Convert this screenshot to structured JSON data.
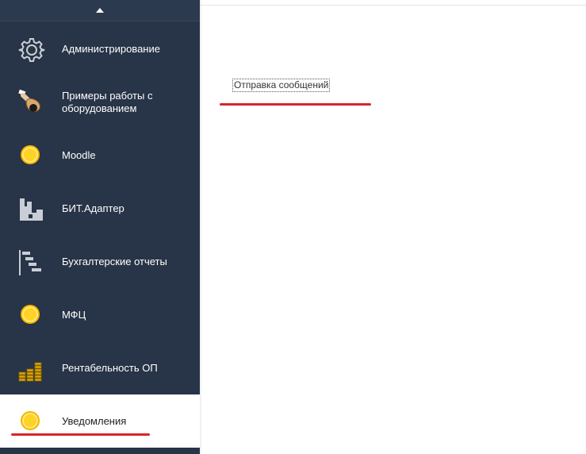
{
  "sidebar": {
    "items": [
      {
        "label": "Администрирование",
        "icon": "gear-icon"
      },
      {
        "label": "Примеры работы с оборудованием",
        "icon": "equipment-icon"
      },
      {
        "label": "Moodle",
        "icon": "coin-icon"
      },
      {
        "label": "БИТ.Адаптер",
        "icon": "factory-icon"
      },
      {
        "label": "Бухгалтерские отчеты",
        "icon": "report-list-icon"
      },
      {
        "label": "МФЦ",
        "icon": "coin-icon"
      },
      {
        "label": "Рентабельность ОП",
        "icon": "coins-stack-icon"
      },
      {
        "label": "Уведомления",
        "icon": "coin-icon",
        "active": true
      }
    ]
  },
  "main": {
    "link_label": "Отправка сообщений"
  },
  "colors": {
    "sidebar_bg": "#283447",
    "active_bg": "#ffffff",
    "coin": "#ffd326",
    "annotation_red": "#d8262c"
  }
}
